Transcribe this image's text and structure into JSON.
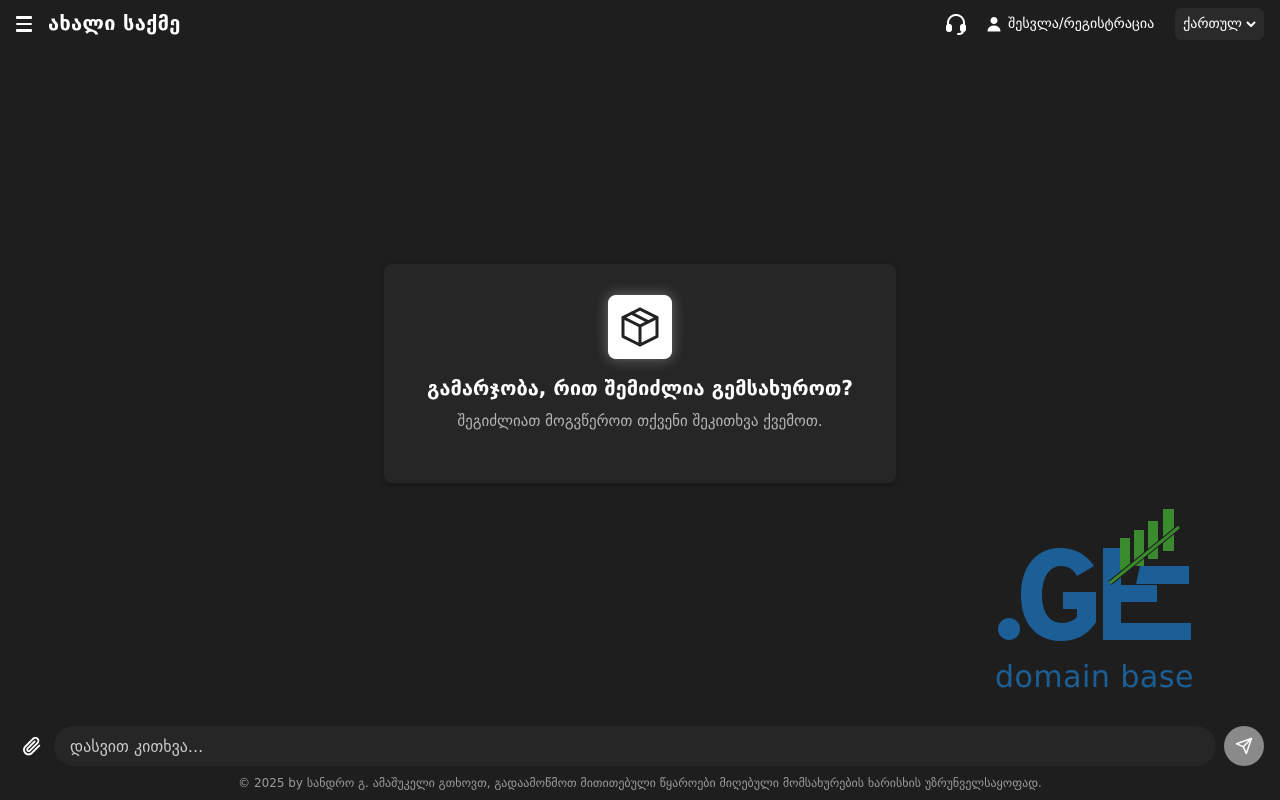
{
  "header": {
    "title": "ახალი საქმე",
    "login_label": "შესვლა/რეგისტრაცია",
    "language": "ქართულ"
  },
  "welcome": {
    "title": "გამარჯობა, რით შემიძლია გემსახუროთ?",
    "subtitle": "შეგიძლიათ მოგვწეროთ თქვენი შეკითხვა ქვემოთ."
  },
  "brand": {
    "logo_text": ".GE",
    "tagline": "domain base",
    "colors": {
      "blue": "#1c5f97",
      "green": "#3a8b2e"
    }
  },
  "composer": {
    "placeholder": "დასვით კითხვა...",
    "value": ""
  },
  "footer": {
    "text": "© 2025 by სანდრო გ. ამაშუკელი გთხოვთ, გადაამოწმოთ მითითებული წყაროები მიღებული მომსახურების ხარისხის უზრუნველსაყოფად."
  },
  "icons": {
    "menu": "hamburger-menu-icon",
    "support": "headset-icon",
    "user": "user-icon",
    "dropdown": "chevron-down-icon",
    "welcome": "box-icon",
    "attach": "paperclip-icon",
    "send": "paper-plane-icon"
  },
  "theme": {
    "background": "#1e1e1e",
    "card": "#262626",
    "send_button": "#8a8a8a"
  }
}
